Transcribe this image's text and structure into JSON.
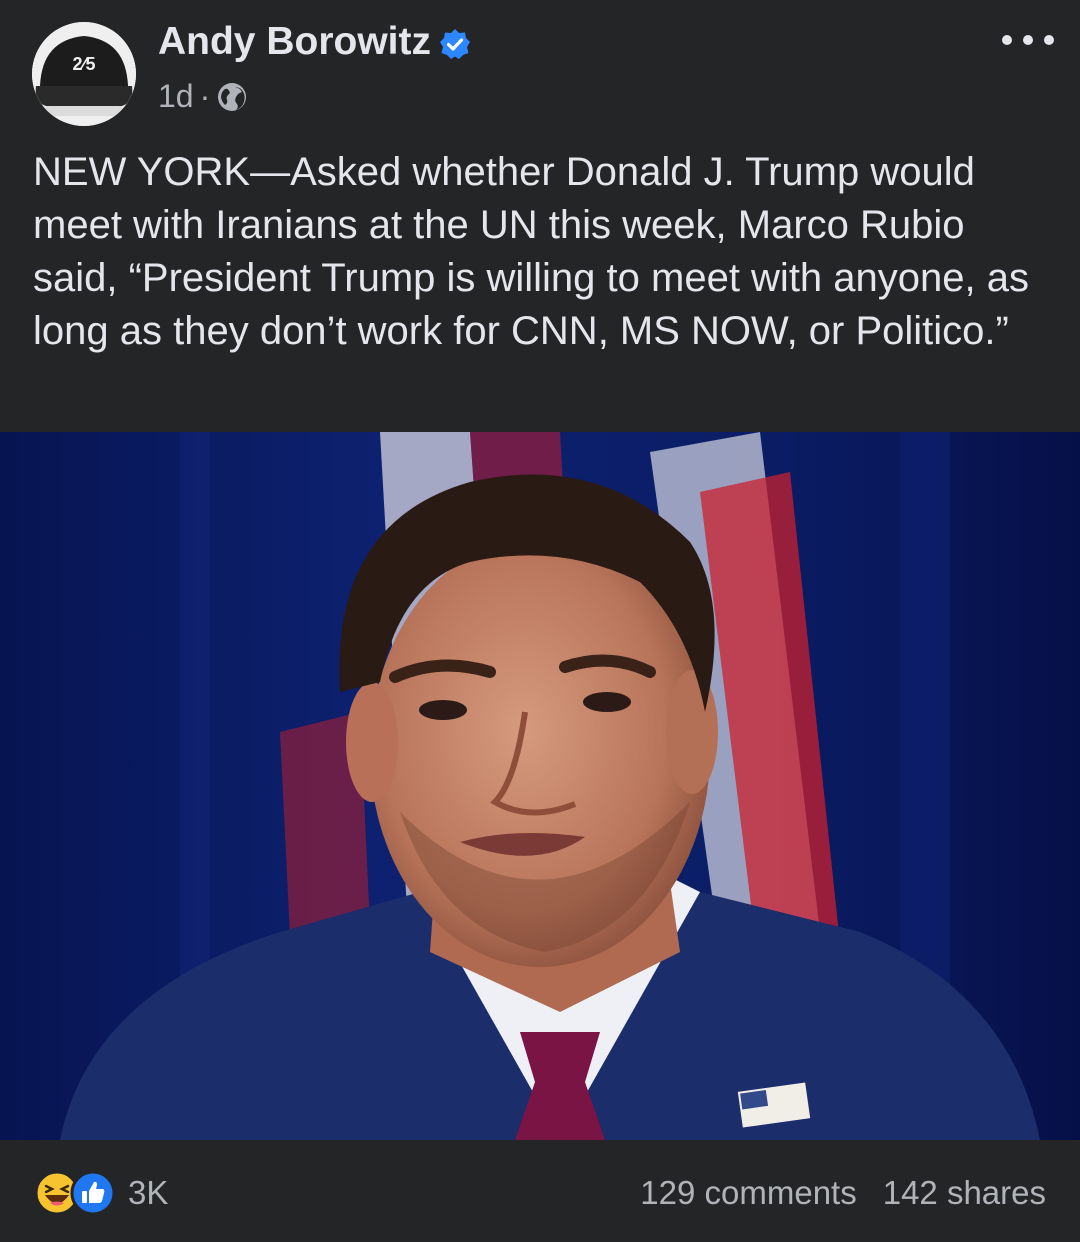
{
  "post": {
    "author": "Andy Borowitz",
    "avatar_text": "2⁄5",
    "time": "1d",
    "separator": "·",
    "audience_icon": "globe-icon",
    "verified_icon": "verified-badge-icon",
    "more_icon": "more-options-icon",
    "text": "NEW YORK—Asked whether Donald J. Trump would meet with Iranians at the UN this week, Marco Rubio said, “President Trump is willing to meet with anyone, as long as they don’t work for CNN, MS NOW, or Politico.”"
  },
  "footer": {
    "reaction_icons": [
      "haha-reaction-icon",
      "like-reaction-icon"
    ],
    "reaction_count": "3K",
    "comments": "129 comments",
    "shares": "142 shares"
  },
  "colors": {
    "background": "#242526",
    "text": "#e4e6eb",
    "secondary_text": "#b0b3b8",
    "verified": "#2d88ff"
  }
}
